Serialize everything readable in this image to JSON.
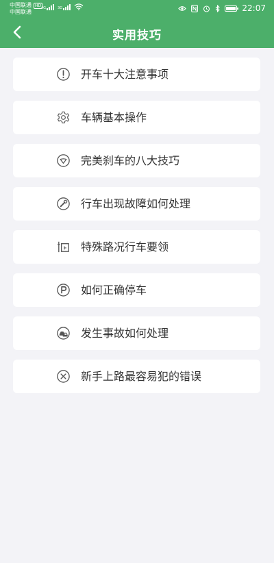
{
  "status_bar": {
    "carrier_1": "中国联通",
    "hd_badge": "HD",
    "carrier_2": "中国联通",
    "network_1": "4G",
    "network_2": "3G",
    "time": "22:07"
  },
  "header": {
    "title": "实用技巧"
  },
  "menu": {
    "items": [
      {
        "label": "开车十大注意事项",
        "icon": "exclamation-circle-icon"
      },
      {
        "label": "车辆基本操作",
        "icon": "gear-icon"
      },
      {
        "label": "完美刹车的八大技巧",
        "icon": "brake-icon"
      },
      {
        "label": "行车出现故障如何处理",
        "icon": "wrench-icon"
      },
      {
        "label": "特殊路况行车要领",
        "icon": "road-sign-icon"
      },
      {
        "label": "如何正确停车",
        "icon": "parking-icon"
      },
      {
        "label": "发生事故如何处理",
        "icon": "car-accident-icon"
      },
      {
        "label": "新手上路最容易犯的错误",
        "icon": "cross-circle-icon"
      }
    ]
  },
  "colors": {
    "primary": "#4caf6a",
    "background": "#f3f3f7",
    "card": "#ffffff",
    "text": "#333333",
    "icon": "#555555"
  }
}
